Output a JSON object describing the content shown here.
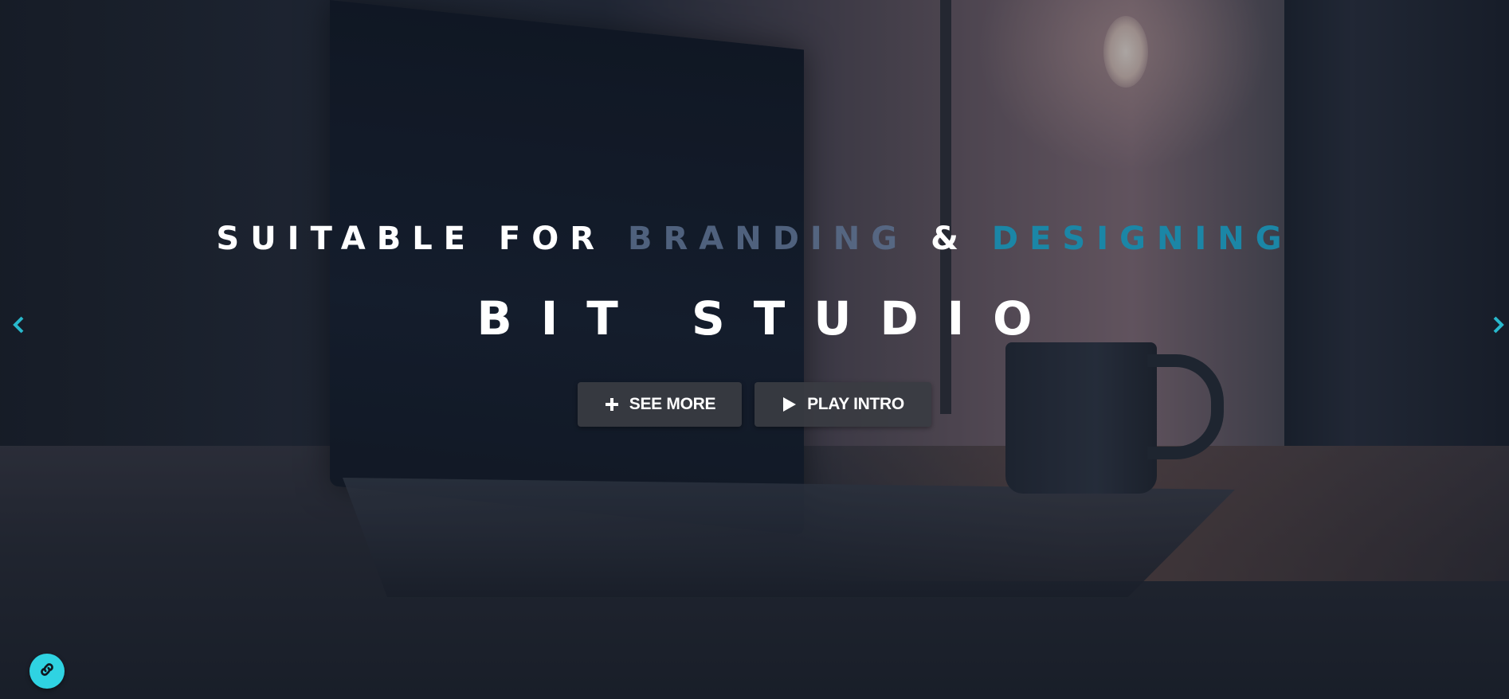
{
  "colors": {
    "accent": "#2fd3e2",
    "arrow": "#28b8cc",
    "button_bg": "#3a3c42",
    "sub_muted": "#5a6e8c",
    "sub_accent": "#1b86a6"
  },
  "hero": {
    "subtitle": {
      "lead": "SUITABLE FOR",
      "word1": "BRANDING",
      "amp": "&",
      "word2": "DESIGNING"
    },
    "title": "BIT STUDIO",
    "buttons": {
      "see_more": {
        "label": "SEE MORE",
        "icon": "plus-icon"
      },
      "play_intro": {
        "label": "PLAY INTRO",
        "icon": "play-icon"
      }
    }
  },
  "carousel": {
    "prev_icon": "chevron-left-icon",
    "next_icon": "chevron-right-icon"
  },
  "fab": {
    "icon": "link-icon"
  }
}
